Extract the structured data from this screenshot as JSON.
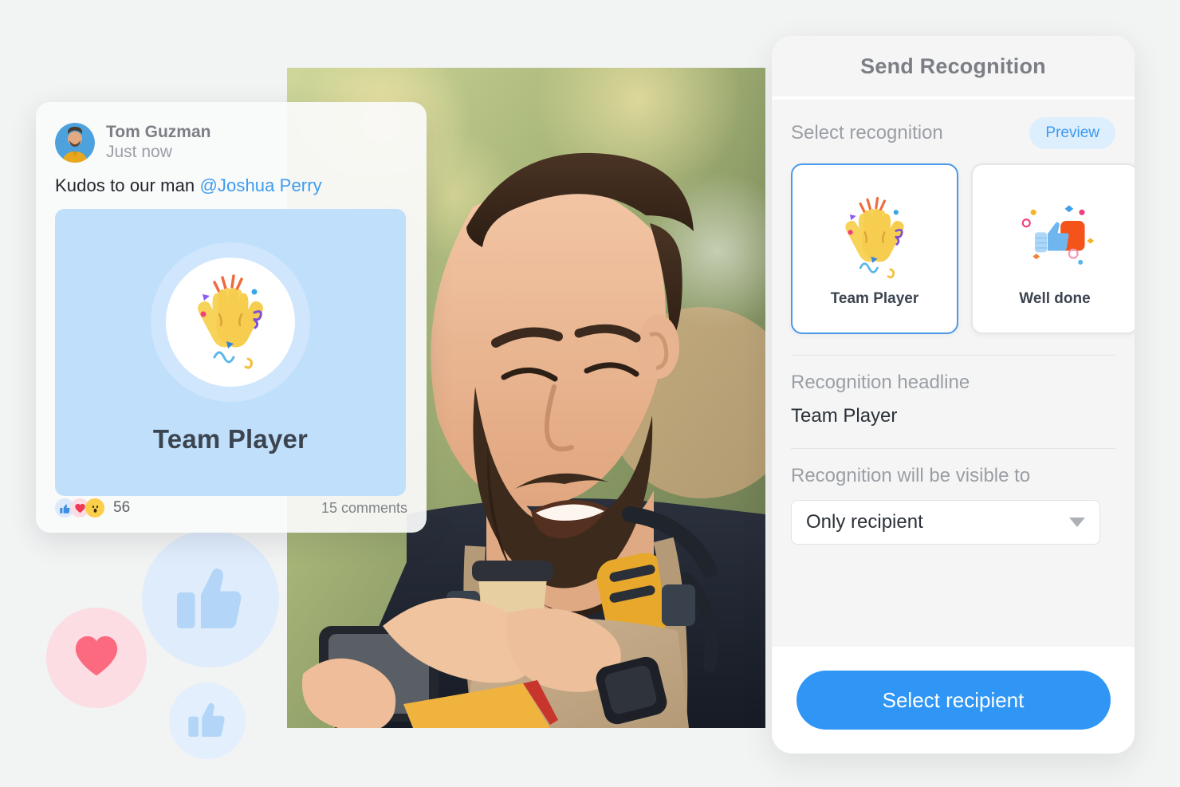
{
  "post": {
    "author": "Tom Guzman",
    "timestamp": "Just now",
    "message_prefix": "Kudos to our man ",
    "mention": "@Joshua Perry",
    "badge_title": "Team Player",
    "badge_icon": "raising-hands-icon",
    "avatar_icon": "user-avatar-photo",
    "reactions": {
      "like_icon": "thumbs-up-icon",
      "love_icon": "heart-icon",
      "wow_icon": "surprised-face-icon",
      "count": "56"
    },
    "comments": "15 comments",
    "badge_bg": "#bfdffb"
  },
  "panel": {
    "title": "Send Recognition",
    "select_label": "Select recognition",
    "preview_label": "Preview",
    "cards": [
      {
        "label": "Team Player",
        "icon": "raising-hands-icon",
        "selected": true
      },
      {
        "label": "Well done",
        "icon": "thumbs-up-confetti-icon",
        "selected": false
      }
    ],
    "headline_label": "Recognition headline",
    "headline_value": "Team Player",
    "visibility_label": "Recognition will be visible to",
    "visibility_value": "Only recipient",
    "visibility_caret": "chevron-down-icon",
    "submit_label": "Select recipient",
    "accent_color": "#2f96f6",
    "selected_border_color": "#4a9ae8"
  },
  "decorations": {
    "bubble_large_icon": "thumbs-up-icon",
    "bubble_heart_icon": "heart-icon",
    "bubble_small_icon": "thumbs-up-icon"
  },
  "photo": {
    "description": "smiling bearded man with ear defenders holding phone and coffee"
  }
}
